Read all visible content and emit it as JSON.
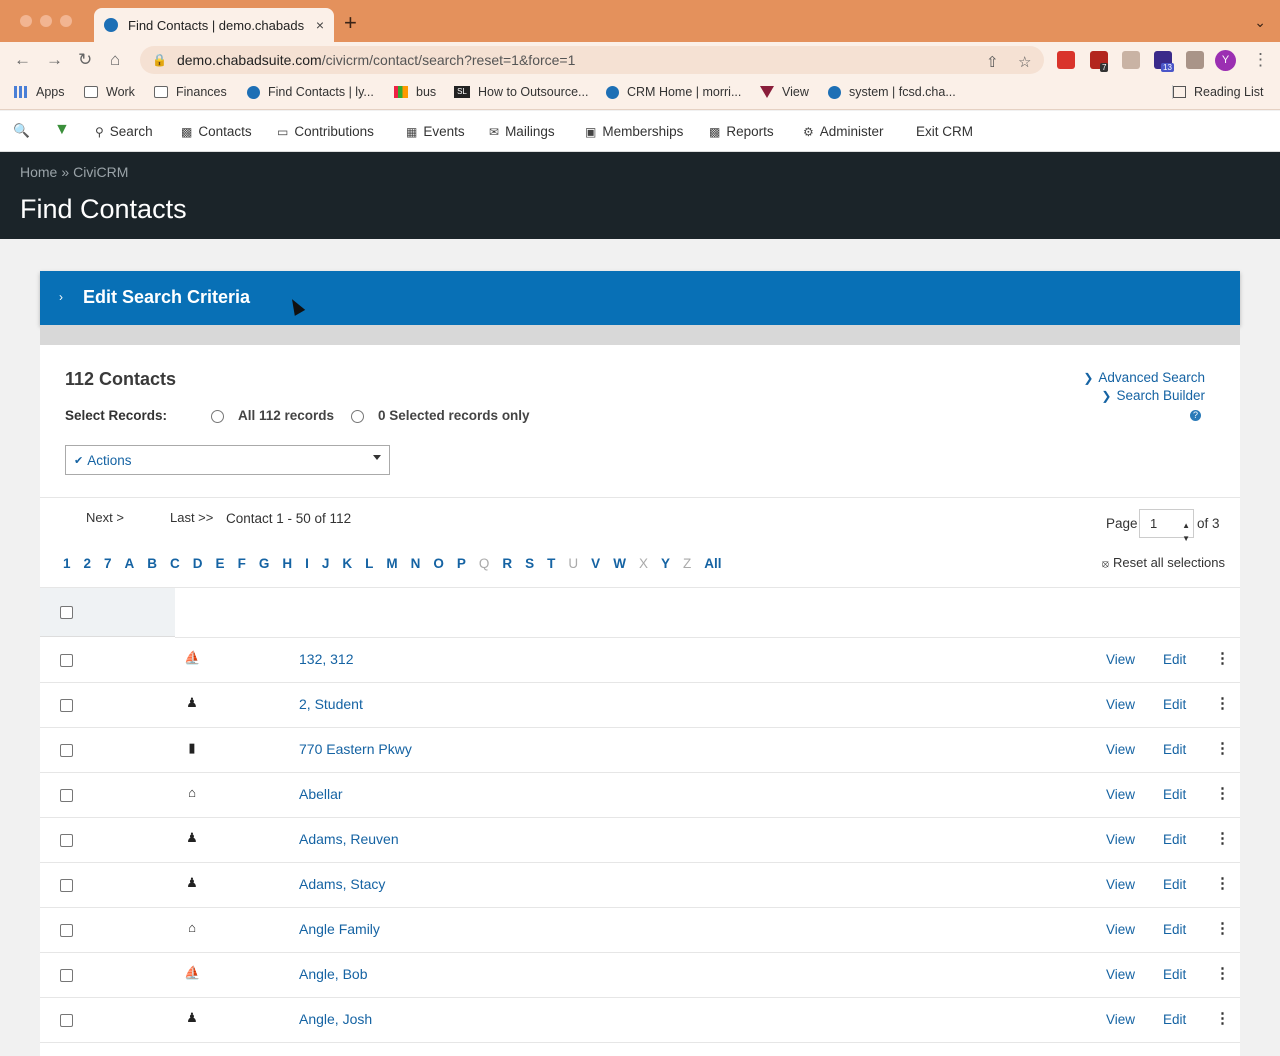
{
  "browser": {
    "tab_title": "Find Contacts | demo.chabads",
    "tab_close": "×",
    "new_tab": "+",
    "url_host": "demo.chabadsuite.com",
    "url_path": "/civicrm/contact/search?reset=1&force=1",
    "profile_initial": "Y",
    "ext_badge_1": "7",
    "ext_badge_2": "13",
    "bookmarks": [
      {
        "label": "Apps"
      },
      {
        "label": "Work"
      },
      {
        "label": "Finances"
      },
      {
        "label": "Find Contacts | ly..."
      },
      {
        "label": "bus"
      },
      {
        "label": "How to Outsource..."
      },
      {
        "label": "CRM Home | morri..."
      },
      {
        "label": "View"
      },
      {
        "label": "system | fcsd.cha..."
      }
    ],
    "reading_list": "Reading List"
  },
  "civimenu": {
    "items": [
      "Search",
      "Contacts",
      "Contributions",
      "Events",
      "Mailings",
      "Memberships",
      "Reports",
      "Administer",
      "Exit CRM"
    ]
  },
  "header": {
    "breadcrumb_home": "Home",
    "breadcrumb_sep": "»",
    "breadcrumb_civi": "CiviCRM",
    "title": "Find Contacts"
  },
  "criteria": {
    "label": "Edit Search Criteria",
    "chevron": "›"
  },
  "results": {
    "count": "112 Contacts",
    "advanced_search": "Advanced Search",
    "search_builder": "Search Builder",
    "help": "?",
    "select_records_label": "Select Records:",
    "all_records": "All 112 records",
    "selected_only": "0 Selected records only",
    "actions_label": "Actions",
    "next": "Next >",
    "last": "Last >>",
    "pager_text": "Contact 1 - 50 of 112",
    "page_label": "Page",
    "page_value": "1",
    "page_of": "of 3",
    "reset_selections": "Reset all selections",
    "alphabet": [
      {
        "l": "1",
        "on": true
      },
      {
        "l": "2",
        "on": true
      },
      {
        "l": "7",
        "on": true
      },
      {
        "l": "A",
        "on": true
      },
      {
        "l": "B",
        "on": true
      },
      {
        "l": "C",
        "on": true
      },
      {
        "l": "D",
        "on": true
      },
      {
        "l": "E",
        "on": true
      },
      {
        "l": "F",
        "on": true
      },
      {
        "l": "G",
        "on": true
      },
      {
        "l": "H",
        "on": true
      },
      {
        "l": "I",
        "on": true
      },
      {
        "l": "J",
        "on": true
      },
      {
        "l": "K",
        "on": true
      },
      {
        "l": "L",
        "on": true
      },
      {
        "l": "M",
        "on": true
      },
      {
        "l": "N",
        "on": true
      },
      {
        "l": "O",
        "on": true
      },
      {
        "l": "P",
        "on": true
      },
      {
        "l": "Q",
        "on": false
      },
      {
        "l": "R",
        "on": true
      },
      {
        "l": "S",
        "on": true
      },
      {
        "l": "T",
        "on": true
      },
      {
        "l": "U",
        "on": false
      },
      {
        "l": "V",
        "on": true
      },
      {
        "l": "W",
        "on": true
      },
      {
        "l": "X",
        "on": false
      },
      {
        "l": "Y",
        "on": true
      },
      {
        "l": "Z",
        "on": false
      },
      {
        "l": "All",
        "on": true
      }
    ],
    "view_label": "View",
    "edit_label": "Edit",
    "more_label": "⋮",
    "rows": [
      {
        "name": "132, 312",
        "type": "student-icon"
      },
      {
        "name": "2, Student",
        "type": "individual-icon"
      },
      {
        "name": "770 Eastern Pkwy",
        "type": "organization-icon"
      },
      {
        "name": "Abellar",
        "type": "household-icon"
      },
      {
        "name": "Adams, Reuven",
        "type": "individual-icon"
      },
      {
        "name": "Adams, Stacy",
        "type": "individual-icon"
      },
      {
        "name": "Angle Family",
        "type": "household-icon"
      },
      {
        "name": "Angle, Bob",
        "type": "student-icon"
      },
      {
        "name": "Angle, Josh",
        "type": "individual-icon"
      }
    ]
  }
}
